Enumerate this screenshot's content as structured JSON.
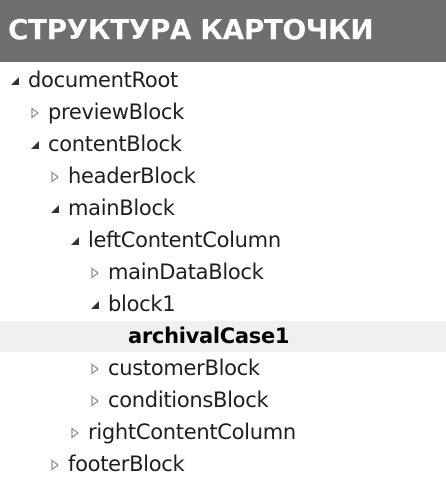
{
  "header": {
    "title": "СТРУКТУРА КАРТОЧКИ",
    "background": "#6f6f6f",
    "text_color": "#ffffff"
  },
  "tree": {
    "selected_background": "#f0f0f0",
    "icon_expanded": "triangle-down-right-icon",
    "icon_collapsed": "triangle-right-outline-icon",
    "nodes": [
      {
        "label": "documentRoot",
        "level": 0,
        "state": "expanded",
        "selected": false
      },
      {
        "label": "previewBlock",
        "level": 1,
        "state": "collapsed",
        "selected": false
      },
      {
        "label": "contentBlock",
        "level": 1,
        "state": "expanded",
        "selected": false
      },
      {
        "label": "headerBlock",
        "level": 2,
        "state": "collapsed",
        "selected": false
      },
      {
        "label": "mainBlock",
        "level": 2,
        "state": "expanded",
        "selected": false
      },
      {
        "label": "leftContentColumn",
        "level": 3,
        "state": "expanded",
        "selected": false
      },
      {
        "label": "mainDataBlock",
        "level": 4,
        "state": "collapsed",
        "selected": false
      },
      {
        "label": "block1",
        "level": 4,
        "state": "expanded",
        "selected": false
      },
      {
        "label": "archivalCase1",
        "level": 5,
        "state": "leaf",
        "selected": true
      },
      {
        "label": "customerBlock",
        "level": 4,
        "state": "collapsed",
        "selected": false
      },
      {
        "label": "conditionsBlock",
        "level": 4,
        "state": "collapsed",
        "selected": false
      },
      {
        "label": "rightContentColumn",
        "level": 3,
        "state": "collapsed",
        "selected": false
      },
      {
        "label": "footerBlock",
        "level": 2,
        "state": "collapsed",
        "selected": false
      }
    ]
  }
}
